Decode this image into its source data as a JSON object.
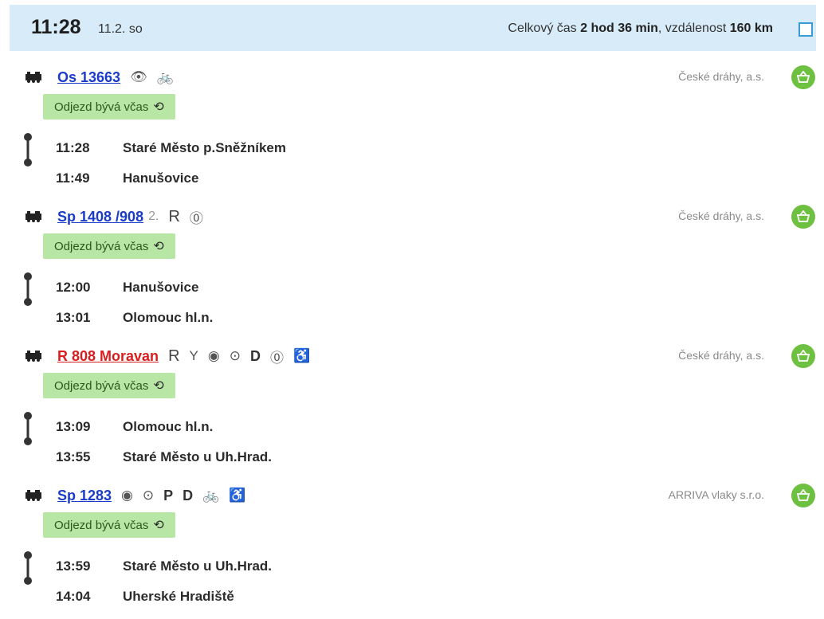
{
  "header": {
    "time": "11:28",
    "date": "11.2. so",
    "summary_prefix": "Celkový čas ",
    "summary_duration": "2 hod 36 min",
    "summary_mid": ", vzdálenost ",
    "summary_distance": "160 km"
  },
  "colors": {
    "link": "#1a3cc8",
    "link_fast": "#d81e1e",
    "badge_bg": "#b8e6a4",
    "basket": "#6dc040",
    "header_bg": "#d8ebf8"
  },
  "trains": [
    {
      "name": "Os 13663",
      "class_label": "",
      "icons": [
        "👁",
        "🚲"
      ],
      "carrier": "České dráhy, a.s.",
      "status": "Odjezd bývá včas",
      "stops": [
        {
          "time": "11:28",
          "station": "Staré Město p.Sněžníkem"
        },
        {
          "time": "11:49",
          "station": "Hanušovice"
        }
      ]
    },
    {
      "name": "Sp 1408 /908",
      "class_label": "2.",
      "icons": [
        "R",
        "⓪"
      ],
      "carrier": "České dráhy, a.s.",
      "status": "Odjezd bývá včas",
      "stops": [
        {
          "time": "12:00",
          "station": "Hanušovice"
        },
        {
          "time": "13:01",
          "station": "Olomouc hl.n."
        }
      ]
    },
    {
      "name": "R 808 Moravan",
      "class_label": "",
      "icons": [
        "R",
        "Y",
        "◉",
        "⊙",
        "D",
        "⓪",
        "♿"
      ],
      "carrier": "České dráhy, a.s.",
      "status": "Odjezd bývá včas",
      "stops": [
        {
          "time": "13:09",
          "station": "Olomouc hl.n."
        },
        {
          "time": "13:55",
          "station": "Staré Město u Uh.Hrad."
        }
      ]
    },
    {
      "name": "Sp 1283",
      "class_label": "",
      "icons": [
        "◉",
        "⊙",
        "P",
        "D",
        "🚲",
        "♿"
      ],
      "carrier": "ARRIVA vlaky s.r.o.",
      "status": "Odjezd bývá včas",
      "stops": [
        {
          "time": "13:59",
          "station": "Staré Město u Uh.Hrad."
        },
        {
          "time": "14:04",
          "station": "Uherské Hradiště"
        }
      ]
    }
  ]
}
